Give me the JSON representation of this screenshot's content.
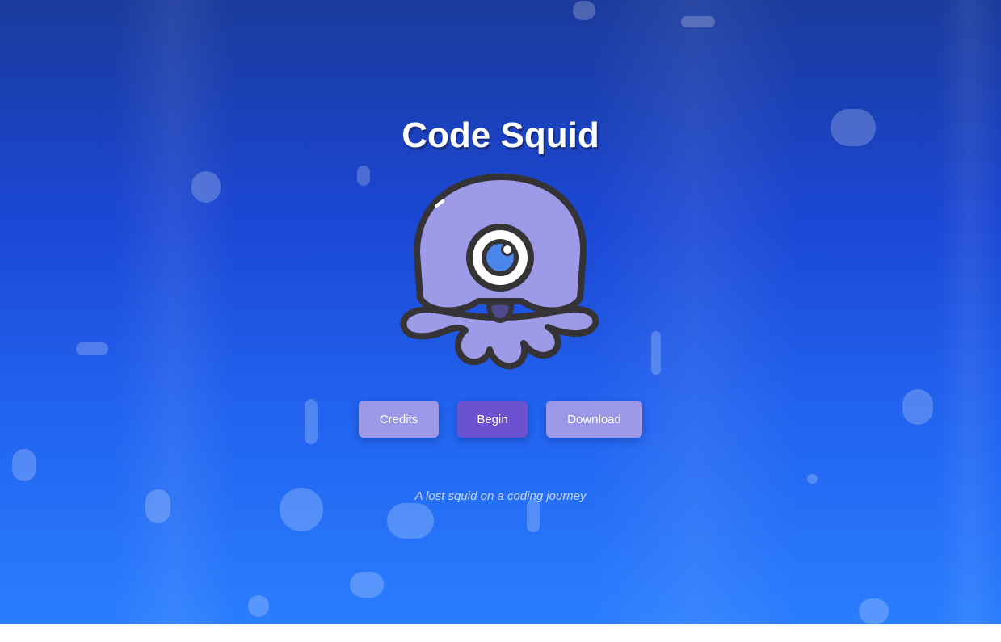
{
  "game": {
    "title": "Code Squid",
    "tagline": "A lost squid on a coding journey"
  },
  "menu": {
    "credits_label": "Credits",
    "begin_label": "Begin",
    "download_label": "Download"
  },
  "mascot": {
    "icon": "squid-icon",
    "body_color": "#9d9be8",
    "outline_color": "#353335",
    "eye_color": "#4a86ec"
  },
  "colors": {
    "background_top": "#1a3a9c",
    "background_bottom": "#2a7dff",
    "button_primary": "#6b52d0",
    "button_secondary": "#9c98e8"
  }
}
